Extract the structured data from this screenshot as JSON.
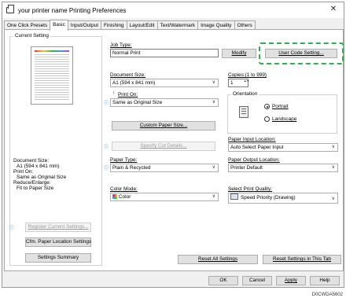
{
  "window": {
    "title": "your printer name Printing Preferences",
    "close_glyph": "✕"
  },
  "tabs": [
    "One Click Presets",
    "Basic",
    "Input/Output",
    "Finishing",
    "Layout/Edit",
    "Text/Watermark",
    "Image Quality",
    "Others"
  ],
  "left": {
    "current_setting_title": "Current Setting",
    "summary": [
      "Document Size:",
      "A1 (594 x 841 mm)",
      "Print On:",
      "Same as Original Size",
      "Reduce/Enlarge:",
      "Fit to Paper Size"
    ],
    "register_button": "Register Current Settings...",
    "cfm_button": "Cfm. Paper Location Settings",
    "summary_button": "Settings Summary"
  },
  "job": {
    "label": "Job Type:",
    "value": "Normal Print",
    "modify_button": "Modify",
    "user_code_button": "User Code Setting..."
  },
  "copies": {
    "label": "Copies:(1 to 999)",
    "value": "1",
    "spin_glyph": "▲▼"
  },
  "document_size": {
    "label": "Document Size:",
    "value": "A1 (594 x 841 mm)"
  },
  "print_on": {
    "label": "Print On:",
    "value": "Same as Original Size",
    "arrow": "↓"
  },
  "orientation": {
    "label": "Orientation",
    "portrait": "Portrait",
    "landscape": "Landscape",
    "selected": "Portrait"
  },
  "custom_paper_button": "Custom Paper Size...",
  "specify_cut_button": "Specify Cut Details...",
  "paper_input": {
    "label": "Paper Input Location:",
    "value": "Auto Select Paper Input"
  },
  "paper_type": {
    "label": "Paper Type:",
    "value": "Plain & Recycled"
  },
  "paper_output": {
    "label": "Paper Output Location:",
    "value": "Printer Default"
  },
  "color_mode": {
    "label": "Color Mode:",
    "value": "Color"
  },
  "print_quality": {
    "label": "Select Print Quality:",
    "value": "Speed Priority (Drawing)"
  },
  "reset_all_button": "Reset All Settings",
  "reset_tab_button": "Reset Settings in This Tab",
  "footer": {
    "ok": "OK",
    "cancel": "Cancel",
    "apply": "Apply",
    "help": "Help"
  },
  "info_glyph": "ⓘ",
  "caption": "D0CWDA5602",
  "colors": {
    "highlight_dash": "#2bb24c",
    "info_blue": "#1e6fc4"
  }
}
